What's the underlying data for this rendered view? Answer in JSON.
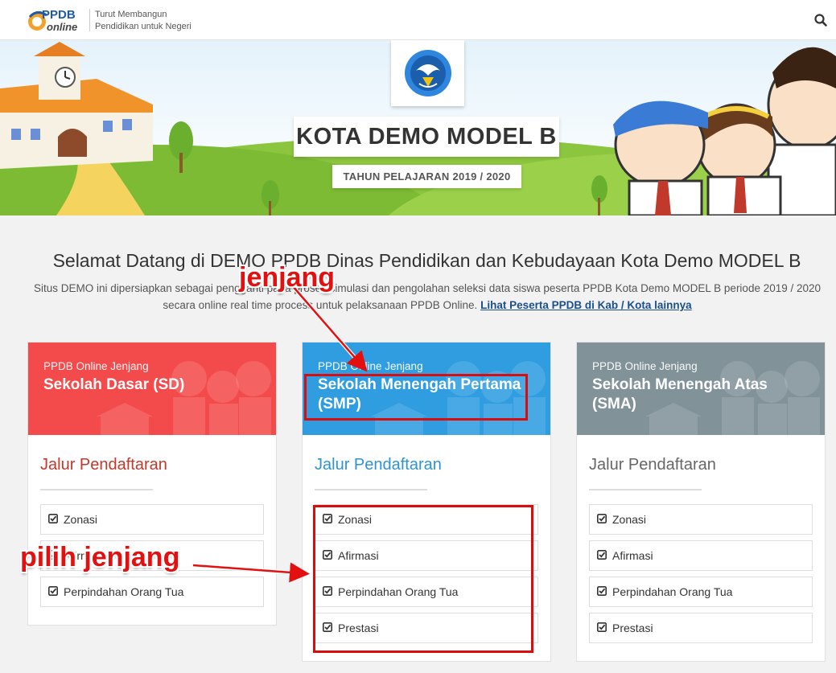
{
  "header": {
    "logo_text": "PPDB online",
    "tagline_line1": "Turut Membangun",
    "tagline_line2": "Pendidikan untuk Negeri"
  },
  "hero": {
    "city_title": "KOTA DEMO MODEL B",
    "year": "TAHUN PELAJARAN 2019 / 2020"
  },
  "welcome": {
    "title": "Selamat Datang di DEMO PPDB Dinas Pendidikan dan Kebudayaan Kota Demo MODEL B",
    "desc_part1": "Situs DEMO ini dipersiapkan sebagai pengganti pada proses simulasi dan pengolahan seleksi data siswa peserta PPDB Kota Demo MODEL B periode 2019 / 2020",
    "desc_part2": "secara online real time process untuk pelaksanaan PPDB Online.",
    "link": "Lihat Peserta PPDB di Kab / Kota lainnya"
  },
  "cards": [
    {
      "subtitle": "PPDB Online Jenjang",
      "title": "Sekolah Dasar (SD)",
      "jalur_title": "Jalur Pendaftaran",
      "items": [
        "Zonasi",
        "Afirmasi",
        "Perpindahan Orang Tua"
      ]
    },
    {
      "subtitle": "PPDB Online Jenjang",
      "title": "Sekolah Menengah Pertama (SMP)",
      "jalur_title": "Jalur Pendaftaran",
      "items": [
        "Zonasi",
        "Afirmasi",
        "Perpindahan Orang Tua",
        "Prestasi"
      ]
    },
    {
      "subtitle": "PPDB Online Jenjang",
      "title": "Sekolah Menengah Atas (SMA)",
      "jalur_title": "Jalur Pendaftaran",
      "items": [
        "Zonasi",
        "Afirmasi",
        "Perpindahan Orang Tua",
        "Prestasi"
      ]
    }
  ],
  "annotations": {
    "jenjang": "jenjang",
    "pilih": "pilih jenjang"
  },
  "colors": {
    "sd": "#f34b4b",
    "smp": "#2f9de0",
    "sma": "#819299",
    "annotation": "#e41010"
  }
}
